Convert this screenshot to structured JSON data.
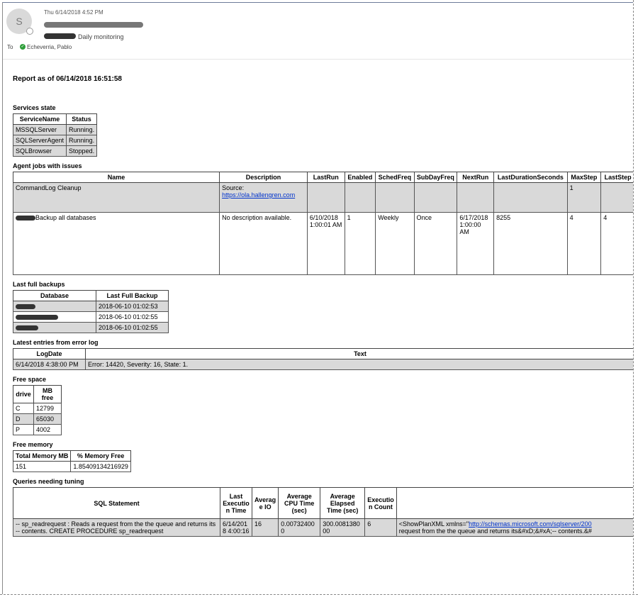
{
  "email": {
    "avatar_initial": "S",
    "datetime": "Thu 6/14/2018 4:52 PM",
    "subject": "Daily monitoring",
    "to_label": "To",
    "to_name": "Echeverria, Pablo"
  },
  "report": {
    "title": "Report as of 06/14/2018 16:51:58"
  },
  "services": {
    "title": "Services state",
    "headers": [
      "ServiceName",
      "Status"
    ],
    "rows": [
      [
        "MSSQLServer",
        "Running."
      ],
      [
        "SQLServerAgent",
        "Running."
      ],
      [
        "SQLBrowser",
        "Stopped."
      ]
    ]
  },
  "agent_jobs": {
    "title": "Agent jobs with issues",
    "headers": [
      "Name",
      "Description",
      "LastRun",
      "Enabled",
      "SchedFreq",
      "SubDayFreq",
      "NextRun",
      "LastDurationSeconds",
      "MaxStep",
      "LastStep"
    ],
    "rows": [
      {
        "name": "CommandLog Cleanup",
        "description": "Source:",
        "description_link": "https://ola.hallengren.com",
        "lastrun": "",
        "enabled": "",
        "schedfreq": "",
        "subdayfreq": "",
        "nextrun": "",
        "lastduration": "",
        "maxstep": "1",
        "laststep": ""
      },
      {
        "name": "Backup all databases",
        "description": "No description available.",
        "description_link": "",
        "lastrun": "6/10/2018 1:00:01 AM",
        "enabled": "1",
        "schedfreq": "Weekly",
        "subdayfreq": "Once",
        "nextrun": "6/17/2018 1:00:00 AM",
        "lastduration": "8255",
        "maxstep": "4",
        "laststep": "4"
      }
    ]
  },
  "backups": {
    "title": "Last full backups",
    "headers": [
      "Database",
      "Last Full Backup"
    ],
    "rows": [
      [
        "2018-06-10 01:02:53"
      ],
      [
        "2018-06-10 01:02:55"
      ],
      [
        "2018-06-10 01:02:55"
      ]
    ]
  },
  "error_log": {
    "title": "Latest entries from error log",
    "headers": [
      "LogDate",
      "Text"
    ],
    "rows": [
      [
        "6/14/2018 4:38:00 PM",
        "Error: 14420, Severity: 16, State: 1."
      ]
    ]
  },
  "free_space": {
    "title": "Free space",
    "headers": [
      "drive",
      "MB free"
    ],
    "rows": [
      [
        "C",
        "12799"
      ],
      [
        "D",
        "65030"
      ],
      [
        "P",
        "4002"
      ]
    ]
  },
  "free_memory": {
    "title": "Free memory",
    "headers": [
      "Total Memory MB",
      "% Memory Free"
    ],
    "rows": [
      [
        "151",
        "1.85409134216929"
      ]
    ]
  },
  "queries": {
    "title": "Queries needing tuning",
    "headers": [
      "SQL Statement",
      "Last Executio n Time",
      "Averag e IO",
      "Average CPU Time (sec)",
      "Average Elapsed Time (sec)",
      "Executio n Count",
      ""
    ],
    "rows": [
      {
        "sql": "-- sp_readrequest : Reads a request from the the queue and returns its -- contents. CREATE PROCEDURE sp_readrequest",
        "last_exec": "6/14/201 8 4:00:16",
        "avg_io": "16",
        "avg_cpu": "0.00732400 0",
        "avg_elapsed": "300.0081380 00",
        "exec_count": "6",
        "plan_prefix": "<ShowPlanXML xmlns=\"",
        "plan_link": "http://schemas.microsoft.com/sqlserver/200",
        "plan_rest": "request from the the queue and returns its&#xD;&#xA;-- contents.&#"
      }
    ]
  }
}
